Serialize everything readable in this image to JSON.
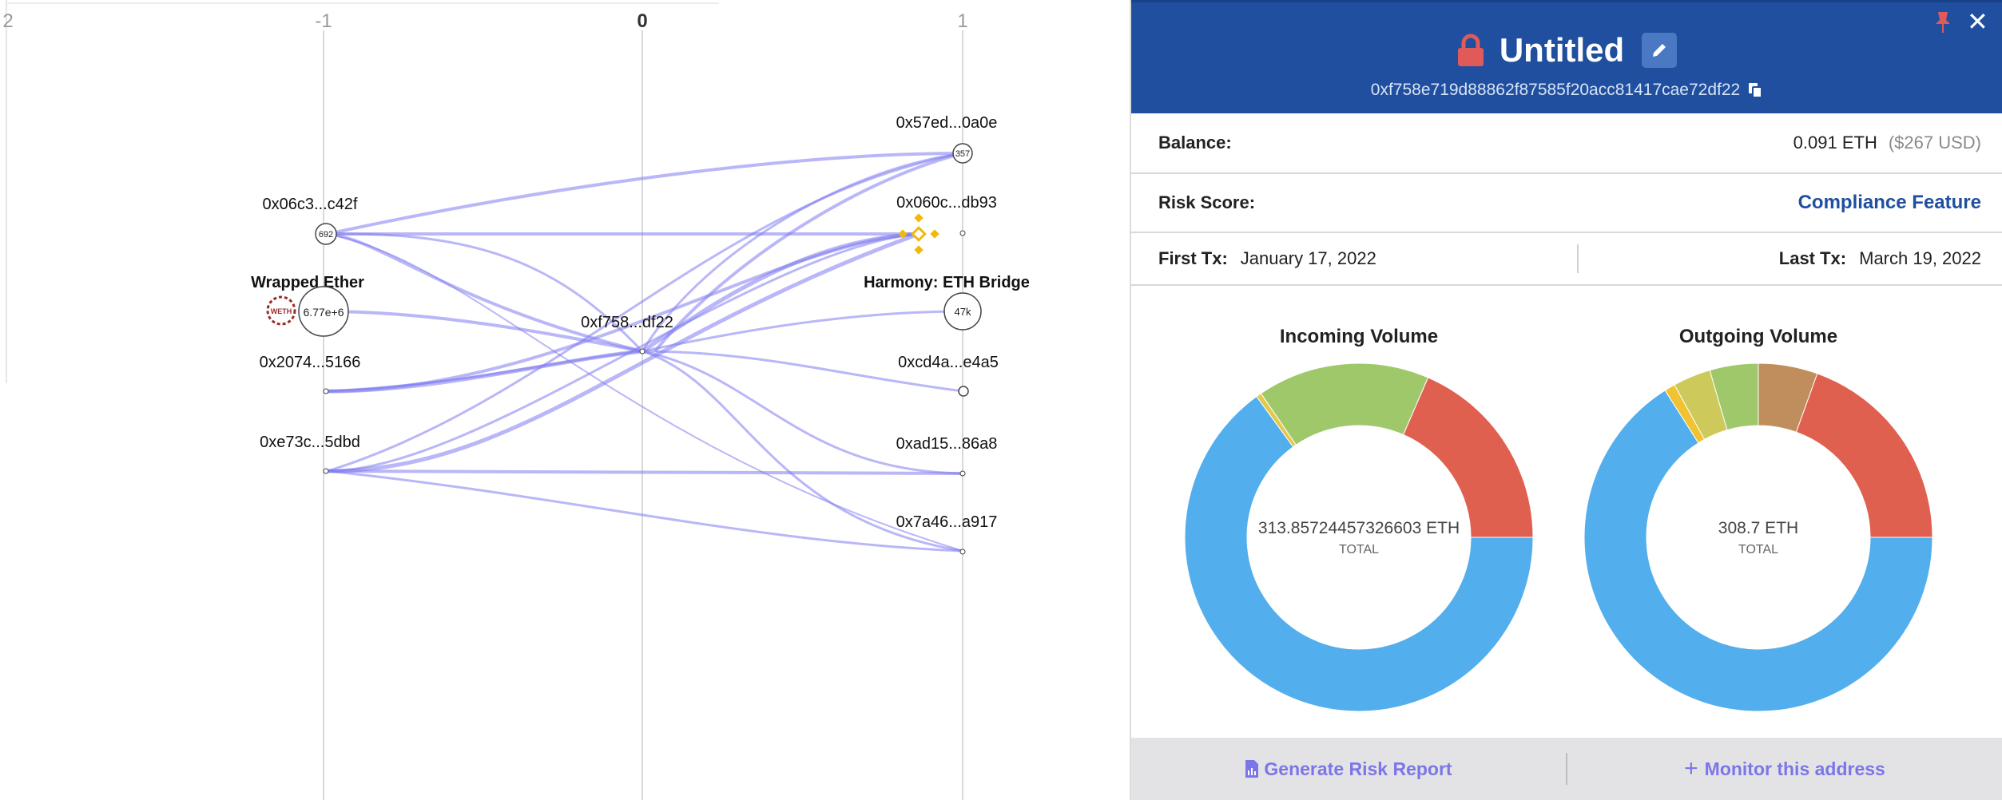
{
  "graph": {
    "axis_labels": [
      "2",
      "-1",
      "0",
      "1"
    ],
    "nodes": {
      "n0x57ed": {
        "label": "0x57ed...0a0e",
        "badge": "357"
      },
      "n0x06c3": {
        "label": "0x06c3...c42f",
        "badge": "692"
      },
      "n0x060c": {
        "label": "0x060c...db93",
        "badge": ""
      },
      "weth": {
        "label": "Wrapped Ether",
        "badge": "6.77e+6",
        "logo_text": "WETH"
      },
      "harmony": {
        "label": "Harmony: ETH Bridge",
        "badge": "47k"
      },
      "center": {
        "label": "0xf758...df22"
      },
      "n0x2074": {
        "label": "0x2074...5166"
      },
      "n0xcd4a": {
        "label": "0xcd4a...e4a5"
      },
      "n0xe73c": {
        "label": "0xe73c...5dbd"
      },
      "n0xad15": {
        "label": "0xad15...86a8"
      },
      "n0x7a46": {
        "label": "0x7a46...a917"
      }
    }
  },
  "panel": {
    "title": "Untitled",
    "address": "0xf758e719d88862f87585f20acc81417cae72df22",
    "balance_label": "Balance:",
    "balance_value": "0.091 ETH",
    "balance_usd": "($267 USD)",
    "risk_label": "Risk Score:",
    "risk_link": "Compliance Feature",
    "first_tx_label": "First Tx:",
    "first_tx_value": "January 17, 2022",
    "last_tx_label": "Last Tx:",
    "last_tx_value": "March 19, 2022",
    "footer": {
      "report_label": "Generate Risk Report",
      "monitor_label": "Monitor this address"
    },
    "colors": {
      "header": "#1f4f9e",
      "accent": "#7b76e8",
      "lock": "#e05a5a"
    }
  },
  "chart_data": [
    {
      "type": "pie",
      "title": "Incoming Volume",
      "center_value": "313.85724457326603 ETH",
      "center_label": "TOTAL",
      "values": [
        0.65,
        0.005,
        0.16,
        0.185
      ],
      "colors": [
        "#52aeed",
        "#e6c84a",
        "#9fc86a",
        "#e06050"
      ]
    },
    {
      "type": "pie",
      "title": "Outgoing Volume",
      "center_value": "308.7 ETH",
      "center_label": "TOTAL",
      "values": [
        0.66,
        0.01,
        0.035,
        0.045,
        0.055,
        0.195
      ],
      "colors": [
        "#52aeed",
        "#f1c232",
        "#cdc95a",
        "#9fc86a",
        "#c08e5c",
        "#e06050"
      ]
    }
  ]
}
